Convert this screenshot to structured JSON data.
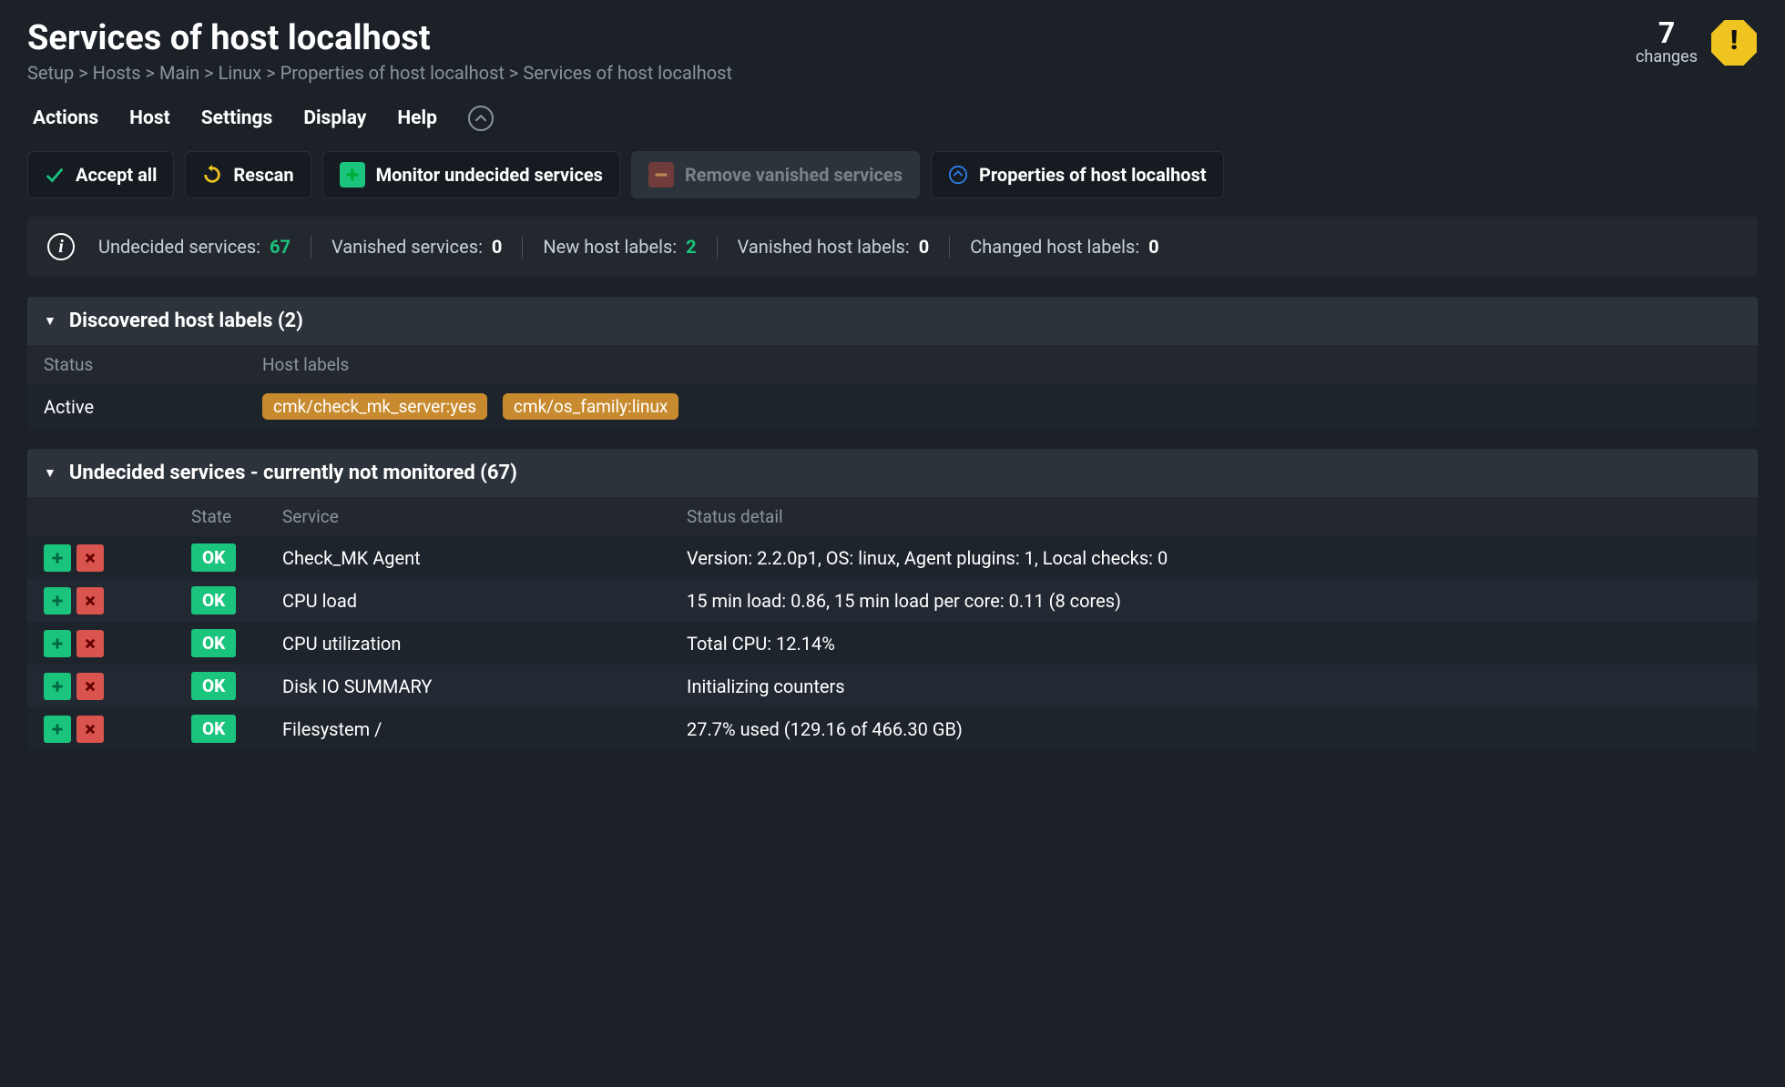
{
  "header": {
    "title": "Services of host localhost",
    "breadcrumbs": [
      "Setup",
      "Hosts",
      "Main",
      "Linux",
      "Properties of host localhost",
      "Services of host localhost"
    ],
    "changes_count": "7",
    "changes_label": "changes"
  },
  "menubar": {
    "actions": "Actions",
    "host": "Host",
    "settings": "Settings",
    "display": "Display",
    "help": "Help"
  },
  "toolbar": {
    "accept_all": "Accept all",
    "rescan": "Rescan",
    "monitor_undecided": "Monitor undecided services",
    "remove_vanished": "Remove vanished services",
    "properties": "Properties of host localhost"
  },
  "stats": {
    "undecided_label": "Undecided services:",
    "undecided_value": "67",
    "vanished_label": "Vanished services:",
    "vanished_value": "0",
    "newlabels_label": "New host labels:",
    "newlabels_value": "2",
    "vanishedlabels_label": "Vanished host labels:",
    "vanishedlabels_value": "0",
    "changedlabels_label": "Changed host labels:",
    "changedlabels_value": "0"
  },
  "discovered_section": {
    "title": "Discovered host labels (2)",
    "col_status": "Status",
    "col_labels": "Host labels",
    "status_value": "Active",
    "labels": [
      "cmk/check_mk_server:yes",
      "cmk/os_family:linux"
    ]
  },
  "undecided_section": {
    "title": "Undecided services - currently not monitored (67)",
    "col_state": "State",
    "col_service": "Service",
    "col_detail": "Status detail",
    "rows": [
      {
        "state": "OK",
        "service": "Check_MK Agent",
        "detail": "Version: 2.2.0p1, OS: linux, Agent plugins: 1, Local checks: 0"
      },
      {
        "state": "OK",
        "service": "CPU load",
        "detail": "15 min load: 0.86, 15 min load per core: 0.11 (8 cores)"
      },
      {
        "state": "OK",
        "service": "CPU utilization",
        "detail": "Total CPU: 12.14%"
      },
      {
        "state": "OK",
        "service": "Disk IO SUMMARY",
        "detail": "Initializing counters"
      },
      {
        "state": "OK",
        "service": "Filesystem /",
        "detail": "27.7% used (129.16 of 466.30 GB)"
      }
    ]
  }
}
